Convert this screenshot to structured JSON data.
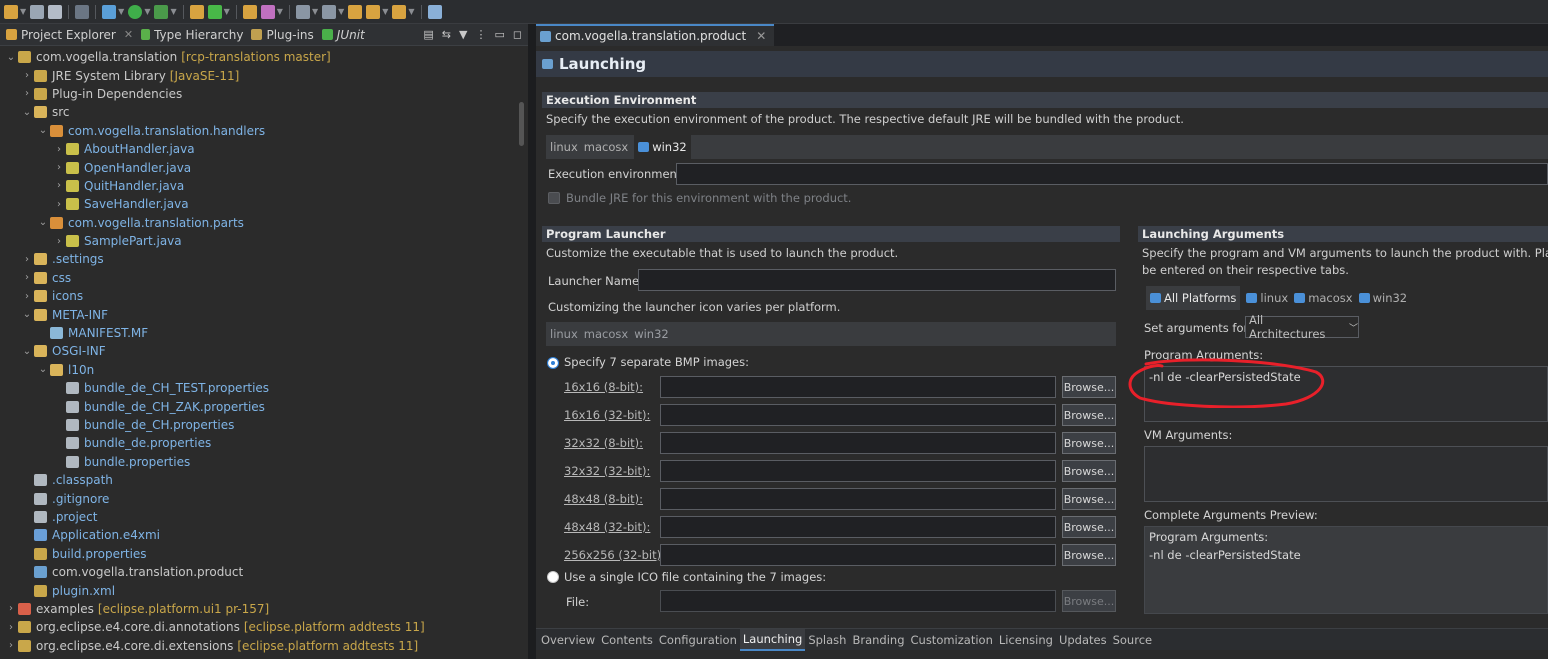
{
  "left_panel": {
    "tabs": [
      {
        "label": "Project Explorer",
        "closable": true
      },
      {
        "label": "Type Hierarchy"
      },
      {
        "label": "Plug-ins"
      },
      {
        "label": "JUnit"
      }
    ],
    "tree": [
      {
        "indent": 0,
        "twisty": "v",
        "icon": "project-icon",
        "label": "com.vogella.translation",
        "deco": "[rcp-translations master]",
        "color": "#c9a74a"
      },
      {
        "indent": 1,
        "twisty": ">",
        "icon": "library-icon",
        "label": "JRE System Library",
        "deco": "[JavaSE-11]",
        "color": "#c9a74a"
      },
      {
        "indent": 1,
        "twisty": ">",
        "icon": "library-icon",
        "label": "Plug-in Dependencies",
        "deco": "",
        "color": "#c9a74a"
      },
      {
        "indent": 1,
        "twisty": "v",
        "icon": "source-folder-icon",
        "label": "src",
        "deco": "",
        "color": "#d9b45a"
      },
      {
        "indent": 2,
        "twisty": "v",
        "icon": "package-icon",
        "label": "com.vogella.translation.handlers",
        "deco": "",
        "color": "#d98f3a",
        "blue": true
      },
      {
        "indent": 3,
        "twisty": ">",
        "icon": "java-file-icon",
        "label": "AboutHandler.java",
        "deco": "",
        "color": "#c9c04a",
        "blue": true
      },
      {
        "indent": 3,
        "twisty": ">",
        "icon": "java-file-icon",
        "label": "OpenHandler.java",
        "deco": "",
        "color": "#c9c04a",
        "blue": true
      },
      {
        "indent": 3,
        "twisty": ">",
        "icon": "java-file-icon",
        "label": "QuitHandler.java",
        "deco": "",
        "color": "#c9c04a",
        "blue": true
      },
      {
        "indent": 3,
        "twisty": ">",
        "icon": "java-file-icon",
        "label": "SaveHandler.java",
        "deco": "",
        "color": "#c9c04a",
        "blue": true
      },
      {
        "indent": 2,
        "twisty": "v",
        "icon": "package-icon",
        "label": "com.vogella.translation.parts",
        "deco": "",
        "color": "#d98f3a",
        "blue": true
      },
      {
        "indent": 3,
        "twisty": ">",
        "icon": "java-file-icon",
        "label": "SamplePart.java",
        "deco": "",
        "color": "#c9c04a",
        "blue": true
      },
      {
        "indent": 1,
        "twisty": ">",
        "icon": "folder-icon",
        "label": ".settings",
        "deco": "",
        "color": "#d9b45a",
        "blue": true
      },
      {
        "indent": 1,
        "twisty": ">",
        "icon": "folder-icon",
        "label": "css",
        "deco": "",
        "color": "#d9b45a",
        "blue": true
      },
      {
        "indent": 1,
        "twisty": ">",
        "icon": "folder-icon",
        "label": "icons",
        "deco": "",
        "color": "#d9b45a",
        "blue": true
      },
      {
        "indent": 1,
        "twisty": "v",
        "icon": "folder-icon",
        "label": "META-INF",
        "deco": "",
        "color": "#d9b45a",
        "blue": true
      },
      {
        "indent": 2,
        "twisty": "",
        "icon": "manifest-icon",
        "label": "MANIFEST.MF",
        "deco": "",
        "color": "#8bb8d8",
        "blue": true
      },
      {
        "indent": 1,
        "twisty": "v",
        "icon": "folder-icon",
        "label": "OSGI-INF",
        "deco": "",
        "color": "#d9b45a",
        "blue": true
      },
      {
        "indent": 2,
        "twisty": "v",
        "icon": "folder-icon",
        "label": "l10n",
        "deco": "",
        "color": "#d9b45a",
        "blue": true
      },
      {
        "indent": 3,
        "twisty": "",
        "icon": "properties-file-icon",
        "label": "bundle_de_CH_TEST.properties",
        "deco": "",
        "color": "#b0b8c0",
        "blue": true
      },
      {
        "indent": 3,
        "twisty": "",
        "icon": "properties-file-icon",
        "label": "bundle_de_CH_ZAK.properties",
        "deco": "",
        "color": "#b0b8c0",
        "blue": true
      },
      {
        "indent": 3,
        "twisty": "",
        "icon": "properties-file-icon",
        "label": "bundle_de_CH.properties",
        "deco": "",
        "color": "#b0b8c0",
        "blue": true
      },
      {
        "indent": 3,
        "twisty": "",
        "icon": "properties-file-icon",
        "label": "bundle_de.properties",
        "deco": "",
        "color": "#b0b8c0",
        "blue": true
      },
      {
        "indent": 3,
        "twisty": "",
        "icon": "properties-file-icon",
        "label": "bundle.properties",
        "deco": "",
        "color": "#b0b8c0",
        "blue": true
      },
      {
        "indent": 1,
        "twisty": "",
        "icon": "file-icon",
        "label": ".classpath",
        "deco": "",
        "color": "#b0b8c0",
        "blue": true
      },
      {
        "indent": 1,
        "twisty": "",
        "icon": "file-icon",
        "label": ".gitignore",
        "deco": "",
        "color": "#b0b8c0",
        "blue": true
      },
      {
        "indent": 1,
        "twisty": "",
        "icon": "file-icon",
        "label": ".project",
        "deco": "",
        "color": "#b0b8c0",
        "blue": true
      },
      {
        "indent": 1,
        "twisty": "",
        "icon": "e4xmi-icon",
        "label": "Application.e4xmi",
        "deco": "",
        "color": "#6a9fd8",
        "blue": true
      },
      {
        "indent": 1,
        "twisty": "",
        "icon": "build-file-icon",
        "label": "build.properties",
        "deco": "",
        "color": "#c9a74a",
        "blue": true
      },
      {
        "indent": 1,
        "twisty": "",
        "icon": "product-file-icon",
        "label": "com.vogella.translation.product",
        "deco": "",
        "color": "#6aa0d0",
        "blue": false
      },
      {
        "indent": 1,
        "twisty": "",
        "icon": "plugin-xml-icon",
        "label": "plugin.xml",
        "deco": "",
        "color": "#c9a74a",
        "blue": true
      },
      {
        "indent": 0,
        "twisty": ">",
        "icon": "project-icon",
        "label": "examples",
        "deco": "[eclipse.platform.ui1 pr-157]",
        "color": "#d9604a"
      },
      {
        "indent": 0,
        "twisty": ">",
        "icon": "project-icon",
        "label": "org.eclipse.e4.core.di.annotations",
        "deco": "[eclipse.platform addtests 11]",
        "color": "#c9a74a"
      },
      {
        "indent": 0,
        "twisty": ">",
        "icon": "project-icon",
        "label": "org.eclipse.e4.core.di.extensions",
        "deco": "[eclipse.platform addtests 11]",
        "color": "#c9a74a"
      }
    ]
  },
  "editor": {
    "tab_label": "com.vogella.translation.product",
    "page_title": "Launching",
    "exec_env": {
      "title": "Execution Environment",
      "desc": "Specify the execution environment of the product. The respective default JRE will be bundled with the product.",
      "platforms": [
        "linux",
        "macosx",
        "win32"
      ],
      "selected": "win32",
      "env_label": "Execution environment:",
      "env_value": "",
      "bundle_label": "Bundle JRE for this environment with the product."
    },
    "launcher": {
      "title": "Program Launcher",
      "desc": "Customize the executable that is used to launch the product.",
      "name_label": "Launcher Name:",
      "name_value": "",
      "icon_desc": "Customizing the launcher icon varies per platform.",
      "platforms": [
        "linux",
        "macosx",
        "win32"
      ],
      "radio_bmp": "Specify 7 separate BMP images:",
      "bmp_sizes": [
        "16x16 (8-bit):",
        "16x16 (32-bit):",
        "32x32 (8-bit):",
        "32x32 (32-bit):",
        "48x48 (8-bit):",
        "48x48 (32-bit):",
        "256x256 (32-bit):"
      ],
      "browse_label": "Browse...",
      "radio_ico": "Use a single ICO file containing the 7 images:",
      "file_label": "File:"
    },
    "args": {
      "title": "Launching Arguments",
      "desc_line1": "Specify the program and VM arguments to launch the product with.  Platform",
      "desc_line2": "be entered on their respective tabs.",
      "platforms": [
        "All Platforms",
        "linux",
        "macosx",
        "win32"
      ],
      "set_for_label": "Set arguments for:",
      "arch_value": "All Architectures",
      "program_label": "Program Arguments:",
      "program_value": "-nl de -clearPersistedState",
      "vm_label": "VM Arguments:",
      "vm_value": "",
      "preview_label": "Complete Arguments Preview:",
      "preview_line1": "Program Arguments:",
      "preview_line2": "-nl de -clearPersistedState"
    },
    "bottom_tabs": [
      "Overview",
      "Contents",
      "Configuration",
      "Launching",
      "Splash",
      "Branding",
      "Customization",
      "Licensing",
      "Updates",
      "Source"
    ],
    "active_bottom_tab": "Launching"
  },
  "colors": {
    "annotation": "#e8202a",
    "accent": "#2f7fd6"
  }
}
